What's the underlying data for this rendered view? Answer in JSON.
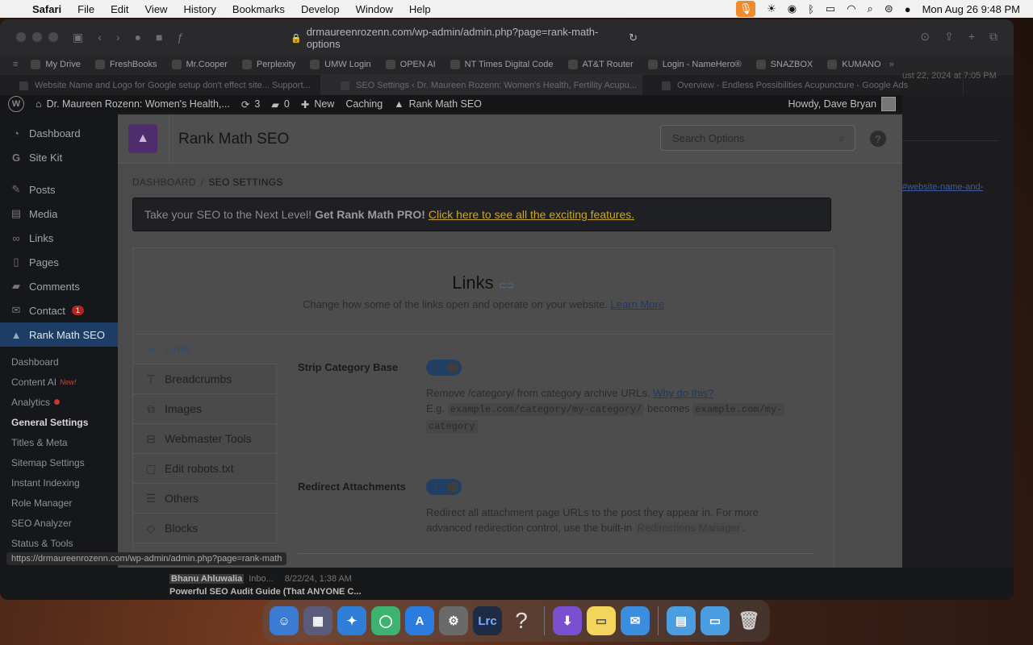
{
  "menubar": {
    "app_name": "Safari",
    "menus": [
      "File",
      "Edit",
      "View",
      "History",
      "Bookmarks",
      "Develop",
      "Window",
      "Help"
    ],
    "clock": "Mon Aug 26  9:48 PM"
  },
  "browser": {
    "url": "drmaureenrozenn.com/wp-admin/admin.php?page=rank-math-options",
    "favorites": [
      "My Drive",
      "FreshBooks",
      "Mr.Cooper",
      "Perplexity",
      "UMW Login",
      "OPEN AI",
      "NT Times Digital Code",
      "AT&T Router",
      "Login - NameHero®",
      "SNAZBOX",
      "KUMANO"
    ],
    "tabs": [
      "Website Name and Logo for Google setup don't effect site... Support...",
      "SEO Settings ‹ Dr. Maureen Rozenn: Women's Health, Fertility Acupu...",
      "Overview - Endless Possibilities Acupuncture - Google Ads"
    ],
    "bg_date": "ust 22, 2024 at 7:05 PM",
    "bg_link": "#website-name-and-",
    "status_url": "https://drmaureenrozenn.com/wp-admin/admin.php?page=rank-math"
  },
  "adminbar": {
    "site_name": "Dr. Maureen Rozenn: Women's Health,...",
    "updates": "3",
    "comments": "0",
    "new_label": "New",
    "caching": "Caching",
    "rankmath": "Rank Math SEO",
    "howdy": "Howdy, Dave Bryan"
  },
  "sidebar": {
    "items": [
      {
        "label": "Dashboard"
      },
      {
        "label": "Site Kit"
      },
      {
        "label": "Posts"
      },
      {
        "label": "Media"
      },
      {
        "label": "Links"
      },
      {
        "label": "Pages"
      },
      {
        "label": "Comments"
      },
      {
        "label": "Contact",
        "badge": "1"
      },
      {
        "label": "Rank Math SEO"
      }
    ],
    "sub": [
      "Dashboard",
      "Content AI",
      "Analytics",
      "General Settings",
      "Titles & Meta",
      "Sitemap Settings",
      "Instant Indexing",
      "Role Manager",
      "SEO Analyzer",
      "Status & Tools"
    ],
    "new_tag": "New!"
  },
  "rankmath": {
    "title": "Rank Math SEO",
    "search_placeholder": "Search Options",
    "help": "?",
    "breadcrumb": [
      "DASHBOARD",
      "/",
      "SEO SETTINGS"
    ],
    "promo": {
      "text": "Take your SEO to the Next Level!",
      "bold": "Get Rank Math PRO!",
      "link": "Click here to see all the exciting features."
    },
    "panel": {
      "title": "Links",
      "desc": "Change how some of the links open and operate on your website.",
      "learn_more": "Learn More"
    },
    "tabs": [
      "Links",
      "Breadcrumbs",
      "Images",
      "Webmaster Tools",
      "Edit robots.txt",
      "Others",
      "Blocks"
    ],
    "settings": {
      "strip": {
        "label": "Strip Category Base",
        "desc": "Remove /category/ from category archive URLs.",
        "link": "Why do this?",
        "eg": "E.g.",
        "code1": "example.com/category/my-category/",
        "becomes": "becomes",
        "code2a": "example.com/my-",
        "code2b": "category"
      },
      "redirect": {
        "label": "Redirect Attachments",
        "desc": "Redirect all attachment page URLs to the post they appear in. For more advanced redirection control, use the built-in",
        "manager": "Redirections Manager",
        "end": "."
      }
    }
  },
  "notification": {
    "name": "Bhanu Ahluwalia",
    "inbox": "Inbo...",
    "date": "8/22/24, 1:38 AM",
    "subject": "Powerful SEO Audit Guide (That ANYONE C..."
  },
  "dock": {
    "lrc": "Lrc",
    "question": "?"
  }
}
